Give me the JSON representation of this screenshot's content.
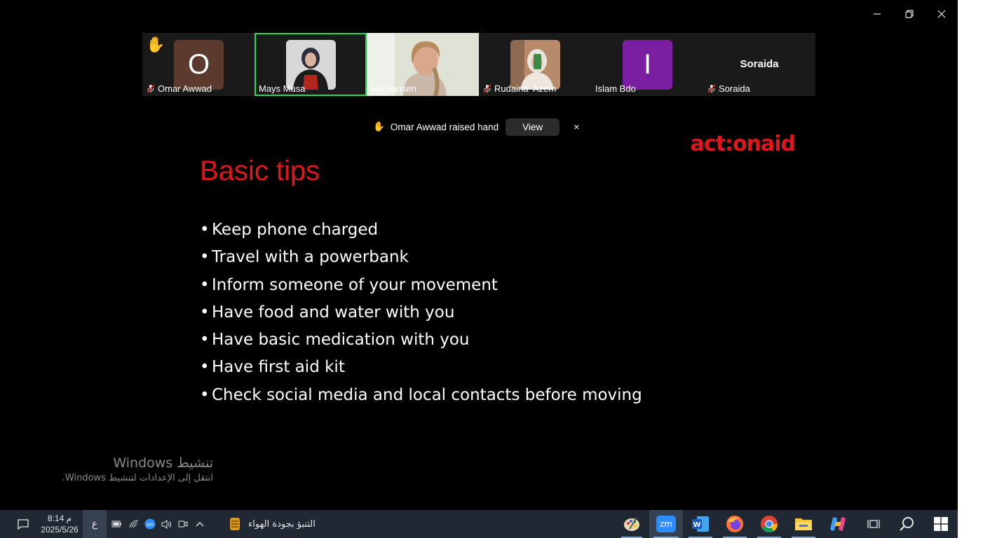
{
  "window": {
    "controls": [
      "minimize",
      "restore",
      "close"
    ]
  },
  "gallery": {
    "participants": [
      {
        "name": "Omar Awwad",
        "initial": "O",
        "avatar_color": "#5c3a2e",
        "muted": true,
        "hand_raised": true,
        "has_video": false,
        "speaking": false
      },
      {
        "name": "Mays Musa",
        "initial": "",
        "avatar_color": "",
        "muted": false,
        "hand_raised": false,
        "has_video": true,
        "speaking": true
      },
      {
        "name": "kiki.hansen",
        "initial": "",
        "avatar_color": "",
        "muted": false,
        "hand_raised": false,
        "has_video": true,
        "speaking": false
      },
      {
        "name": "Rudaina  Azem",
        "initial": "",
        "avatar_color": "",
        "muted": true,
        "hand_raised": false,
        "has_video": true,
        "speaking": false
      },
      {
        "name": "Islam Bdo",
        "initial": "I",
        "avatar_color": "#7b1fa2",
        "muted": false,
        "hand_raised": false,
        "has_video": false,
        "speaking": false
      },
      {
        "name": "Soraida",
        "initial": "Soraida",
        "avatar_color": "",
        "muted": true,
        "hand_raised": false,
        "has_video": false,
        "speaking": false
      }
    ]
  },
  "notification": {
    "hand_icon": "✋",
    "text": "Omar Awwad raised hand",
    "view_label": "View",
    "close_label": "×"
  },
  "slide": {
    "title": "Basic tips",
    "logo": "act:onaid",
    "bullets": [
      "Keep phone charged",
      "Travel with a powerbank",
      "Inform someone of your movement",
      "Have food and water with you",
      "Have basic medication with you",
      "Have first aid kit",
      "Check social media and local contacts before moving"
    ]
  },
  "activation": {
    "title": "تنشيط Windows",
    "subtitle": "انتقل إلى الإعدادات لتنشيط Windows."
  },
  "taskbar": {
    "time": "8:14 م",
    "date": "2025/5/26",
    "language": "ع",
    "weather_text": "التنبؤ بجودة الهواء",
    "apps": [
      "paint-icon",
      "zoom-icon",
      "word-icon",
      "firefox-icon",
      "chrome-icon",
      "file-explorer-icon",
      "copilot-icon",
      "task-view-icon",
      "search-icon",
      "start-icon"
    ],
    "active_app": "zoom-icon",
    "accent": "#7aa7de",
    "bg": "#202833"
  },
  "colors": {
    "brand_red": "#e3151a",
    "speaking_border": "#23d959"
  }
}
